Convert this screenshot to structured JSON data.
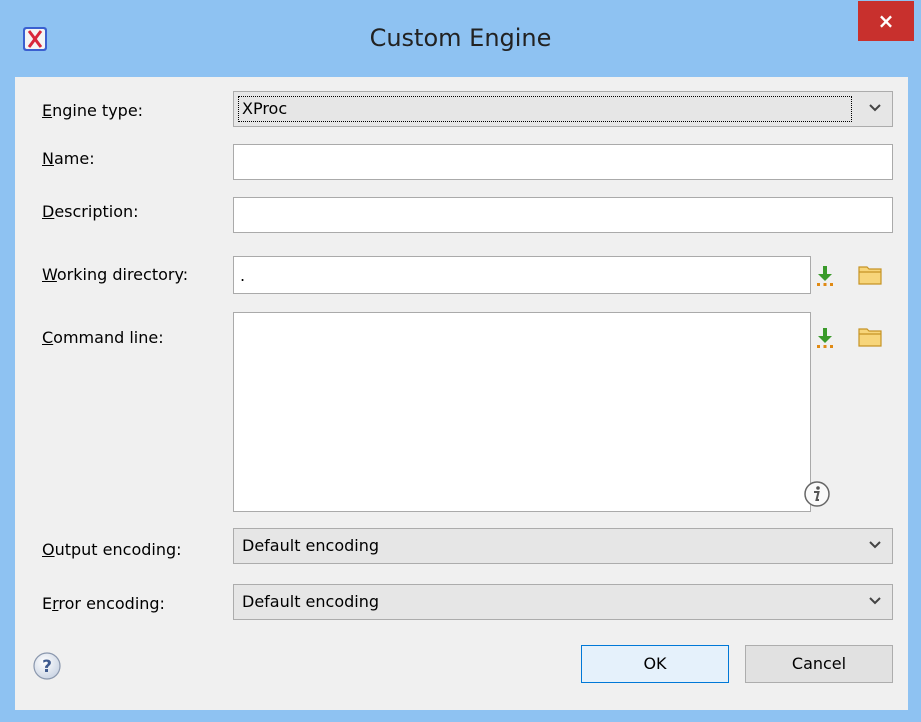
{
  "window": {
    "title": "Custom Engine",
    "close_label": "×"
  },
  "form": {
    "engine_type": {
      "label_key": "E",
      "label_rest": "ngine type:",
      "value": "XProc"
    },
    "name": {
      "label_key": "N",
      "label_rest": "ame:",
      "value": ""
    },
    "description": {
      "label_key": "D",
      "label_rest": "escription:",
      "value": ""
    },
    "working_directory": {
      "label_key": "W",
      "label_rest": "orking directory:",
      "value": "."
    },
    "command_line": {
      "label_key": "C",
      "label_rest": "ommand line:",
      "value": ""
    },
    "output_encoding": {
      "label_key": "O",
      "label_rest": "utput encoding:",
      "value": "Default encoding"
    },
    "error_encoding": {
      "label_pre": "E",
      "label_key": "r",
      "label_rest": "ror encoding:",
      "value": "Default encoding"
    }
  },
  "buttons": {
    "ok": "OK",
    "cancel": "Cancel"
  },
  "icons": {
    "app": "oxygen-app-icon",
    "insert_editor_variables": "insert-variables-icon",
    "browse_folder": "folder-icon",
    "info": "info-icon",
    "help": "help-icon"
  },
  "colors": {
    "titlebar": "#8ec2f2",
    "close_button": "#c8302d",
    "dialog_bg": "#f0f0f0",
    "default_button_border": "#0078d7"
  }
}
